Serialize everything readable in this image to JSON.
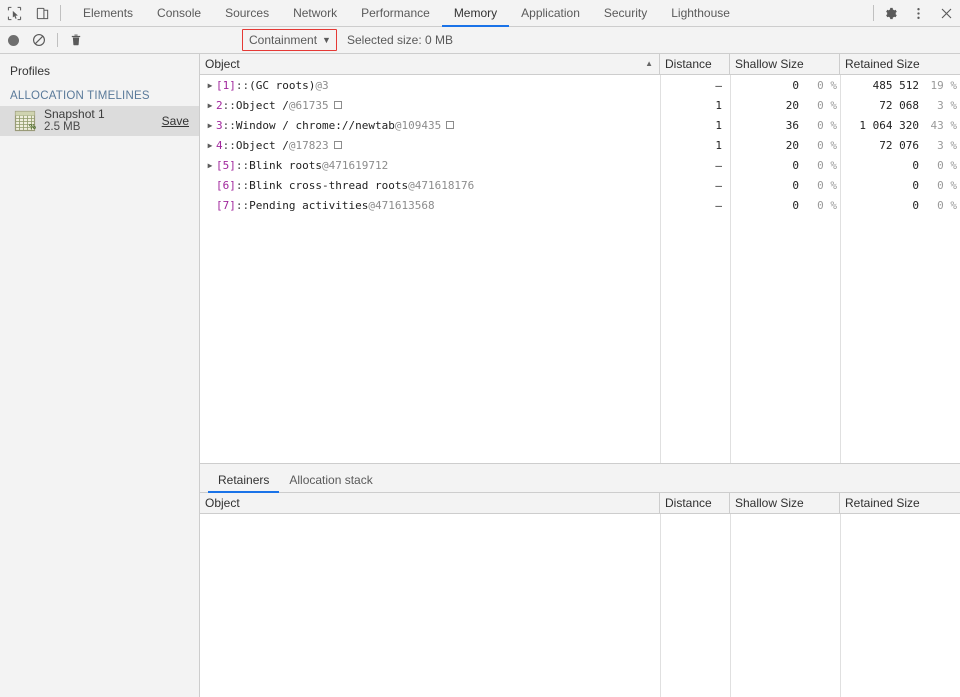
{
  "toolbar": {
    "inspect_icon": "inspect-cursor-icon",
    "device_icon": "device-toolbar-icon",
    "tabs": [
      {
        "label": "Elements",
        "active": false
      },
      {
        "label": "Console",
        "active": false
      },
      {
        "label": "Sources",
        "active": false
      },
      {
        "label": "Network",
        "active": false
      },
      {
        "label": "Performance",
        "active": false
      },
      {
        "label": "Memory",
        "active": true
      },
      {
        "label": "Application",
        "active": false
      },
      {
        "label": "Security",
        "active": false
      },
      {
        "label": "Lighthouse",
        "active": false
      }
    ],
    "settings_icon": "gear-icon",
    "more_icon": "kebab-menu-icon",
    "close_icon": "close-icon"
  },
  "subtoolbar": {
    "record_icon": "record-circle-icon",
    "clear_icon": "no-entry-icon",
    "delete_icon": "trash-icon",
    "view_select": "Containment",
    "view_caret": "▼",
    "selected_size": "Selected size: 0 MB",
    "highlight_color": "#e53935"
  },
  "sidebar": {
    "title": "Profiles",
    "section_label": "ALLOCATION TIMELINES",
    "snapshot": {
      "icon": "heap-snapshot-icon",
      "name": "Snapshot 1",
      "size": "2.5 MB",
      "save_label": "Save"
    }
  },
  "grid": {
    "columns": [
      {
        "label": "Object",
        "sort": "▲"
      },
      {
        "label": "Distance",
        "sort": ""
      },
      {
        "label": "Shallow Size",
        "sort": ""
      },
      {
        "label": "Retained Size",
        "sort": ""
      }
    ],
    "rows": [
      {
        "disclosure": "▶",
        "index": "[1]",
        "sep": " :: ",
        "name": "(GC roots)",
        "objid": "@3",
        "box": false,
        "distance": "–",
        "shallow": "0",
        "shallow_pct": "0 %",
        "retained": "485 512",
        "retained_pct": "19 %"
      },
      {
        "disclosure": "▶",
        "index": "2",
        "sep": " :: ",
        "name": "Object / ",
        "objid": " @61735",
        "box": true,
        "distance": "1",
        "shallow": "20",
        "shallow_pct": "0 %",
        "retained": "72 068",
        "retained_pct": "3 %"
      },
      {
        "disclosure": "▶",
        "index": "3",
        "sep": " :: ",
        "name": "Window / chrome://newtab",
        "objid": " @109435",
        "box": true,
        "distance": "1",
        "shallow": "36",
        "shallow_pct": "0 %",
        "retained": "1 064 320",
        "retained_pct": "43 %"
      },
      {
        "disclosure": "▶",
        "index": "4",
        "sep": " :: ",
        "name": "Object / ",
        "objid": " @17823",
        "box": true,
        "distance": "1",
        "shallow": "20",
        "shallow_pct": "0 %",
        "retained": "72 076",
        "retained_pct": "3 %"
      },
      {
        "disclosure": "▶",
        "index": "[5]",
        "sep": " :: ",
        "name": "Blink roots",
        "objid": " @471619712",
        "box": false,
        "distance": "–",
        "shallow": "0",
        "shallow_pct": "0 %",
        "retained": "0",
        "retained_pct": "0 %"
      },
      {
        "disclosure": "",
        "index": "[6]",
        "sep": " :: ",
        "name": "Blink cross-thread roots",
        "objid": " @471618176",
        "box": false,
        "distance": "–",
        "shallow": "0",
        "shallow_pct": "0 %",
        "retained": "0",
        "retained_pct": "0 %"
      },
      {
        "disclosure": "",
        "index": "[7]",
        "sep": " :: ",
        "name": "Pending activities",
        "objid": " @471613568",
        "box": false,
        "distance": "–",
        "shallow": "0",
        "shallow_pct": "0 %",
        "retained": "0",
        "retained_pct": "0 %"
      }
    ]
  },
  "drawer": {
    "tabs": [
      {
        "label": "Retainers",
        "active": true
      },
      {
        "label": "Allocation stack",
        "active": false
      }
    ],
    "columns": [
      {
        "label": "Object"
      },
      {
        "label": "Distance"
      },
      {
        "label": "Shallow Size"
      },
      {
        "label": "Retained Size"
      }
    ]
  }
}
